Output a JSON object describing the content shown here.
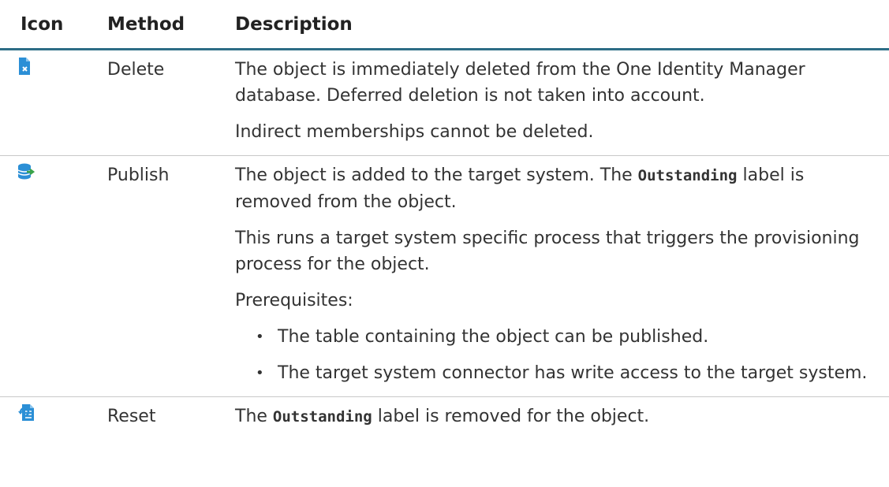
{
  "table": {
    "headers": {
      "icon": "Icon",
      "method": "Method",
      "description": "Description"
    },
    "rows": [
      {
        "icon": "delete-icon",
        "method": "Delete",
        "desc": [
          "The object is immediately deleted from the One Identity Manager database. Deferred deletion is not taken into account.",
          "Indirect memberships cannot be deleted."
        ]
      },
      {
        "icon": "publish-icon",
        "method": "Publish",
        "desc_p1_before": "The object is added to the target system. The ",
        "desc_p1_code": "Outstanding",
        "desc_p1_after": " label is removed from the object.",
        "desc_p2": "This runs a target system specific process that triggers the provisioning process for the object.",
        "desc_p3": "Prerequisites:",
        "prerequisites": [
          "The table containing the object can be published.",
          "The target system connector has write access to the target system."
        ]
      },
      {
        "icon": "reset-icon",
        "method": "Reset",
        "desc_before": "The ",
        "desc_code": "Outstanding",
        "desc_after": " label is removed for the object."
      }
    ]
  },
  "colors": {
    "accent": "#2d6d86",
    "icon_blue": "#2b8fd6"
  }
}
